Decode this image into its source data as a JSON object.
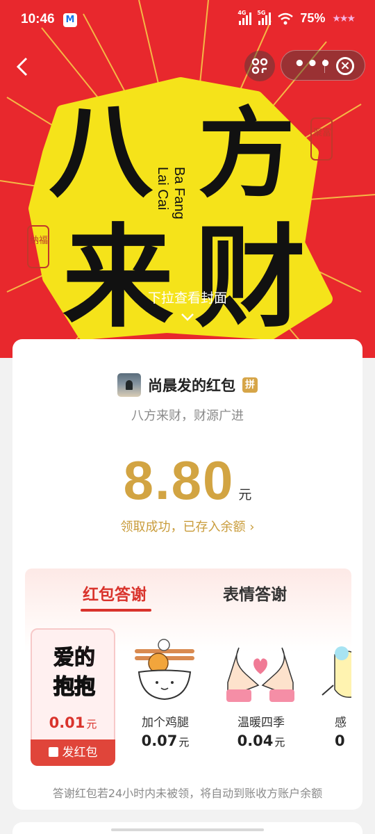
{
  "status_bar": {
    "time": "10:46",
    "mail_icon_letter": "M",
    "net_4g": "4G",
    "net_5g": "5G",
    "battery_pct": "75%"
  },
  "cover": {
    "pull_hint": "下拉查看封面",
    "art_chars": [
      "八",
      "方",
      "来",
      "财"
    ],
    "pinyin_line1": "Ba Fang",
    "pinyin_line2": "Lai Cai",
    "seal_right": "聚富",
    "seal_left": "纳福",
    "background_color": "#e8282d",
    "art_color": "#f5e31a"
  },
  "packet": {
    "sender_name": "尚晨发的红包",
    "pin_badge": "拼",
    "greeting": "八方来财，财源广进",
    "amount": "8.80",
    "amount_unit": "元",
    "received_text": "领取成功，已存入余额",
    "received_chevron": "›"
  },
  "thanks": {
    "tabs": [
      {
        "label": "红包答谢",
        "active": true
      },
      {
        "label": "表情答谢",
        "active": false
      }
    ],
    "gifts": [
      {
        "title_line1": "爱的",
        "title_line2": "抱抱",
        "price": "0.01",
        "unit": "元",
        "selected": true
      },
      {
        "label": "加个鸡腿",
        "price": "0.07",
        "unit": "元",
        "icon": "drumstick-bowl-icon"
      },
      {
        "label": "温暖四季",
        "price": "0.04",
        "unit": "元",
        "icon": "heart-hands-icon"
      },
      {
        "label": "感",
        "price": "0",
        "unit": "",
        "icon": "partial-gift-icon"
      }
    ],
    "send_button_label": "发红包",
    "footnote": "答谢红包若24小时内未被领，将自动到账收方账户余额"
  },
  "colors": {
    "accent_red": "#d9332c",
    "gold": "#d2a442"
  }
}
